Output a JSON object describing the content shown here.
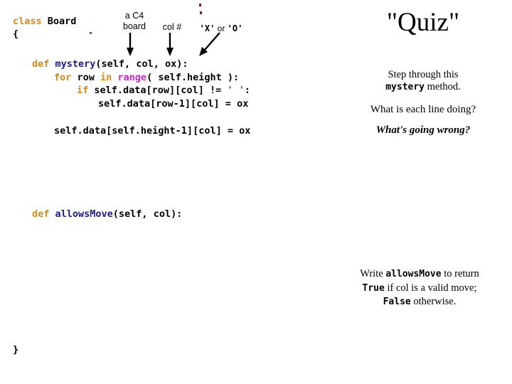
{
  "code": {
    "class_line": {
      "keyword": "class",
      "name": " Board"
    },
    "brace_open": "{",
    "brace_close": "}",
    "mystery_def": {
      "def": "def",
      "name": " mystery",
      "rest": "(self, col, ox):"
    },
    "for_line": {
      "for": "for",
      "var": " row ",
      "in": "in",
      "range": " range",
      "rest": "( self.height ):"
    },
    "if_line": {
      "if": "if",
      "cond": " self.data[row][col] != ",
      "string": "' '",
      "colon": ":"
    },
    "assign_line": "self.data[row-1][col] = ox",
    "final_line": "self.data[self.height-1][col] = ox",
    "allowsmove_def": {
      "def": "def",
      "name": " allowsMove",
      "rest": "(self, col):"
    }
  },
  "annotations": {
    "board_label": "a C4\nboard",
    "col_label": "col #",
    "ox_label_first": "'X'",
    "ox_label_or": " or ",
    "ox_label_second": "'O'"
  },
  "right_panel": {
    "title": "\"Quiz\"",
    "step_note_line1": "Step through this",
    "step_note_code": "mystery",
    "step_note_line2": " method.",
    "question_1": "What is each line doing?",
    "question_2": "What's going wrong?",
    "write_prefix": "Write ",
    "write_code": "allowsMove",
    "write_suffix": " to return",
    "write_true": "True",
    "write_mid": " if col is a valid move;",
    "write_false": "False",
    "write_end": " otherwise."
  },
  "colors": {
    "keyword": "#d18b1e",
    "function": "#1b1b8f",
    "builtin": "#c030c0",
    "string": "#2e7d32",
    "text": "#000000",
    "background": "#ffffff",
    "speck": "#7b2222"
  }
}
